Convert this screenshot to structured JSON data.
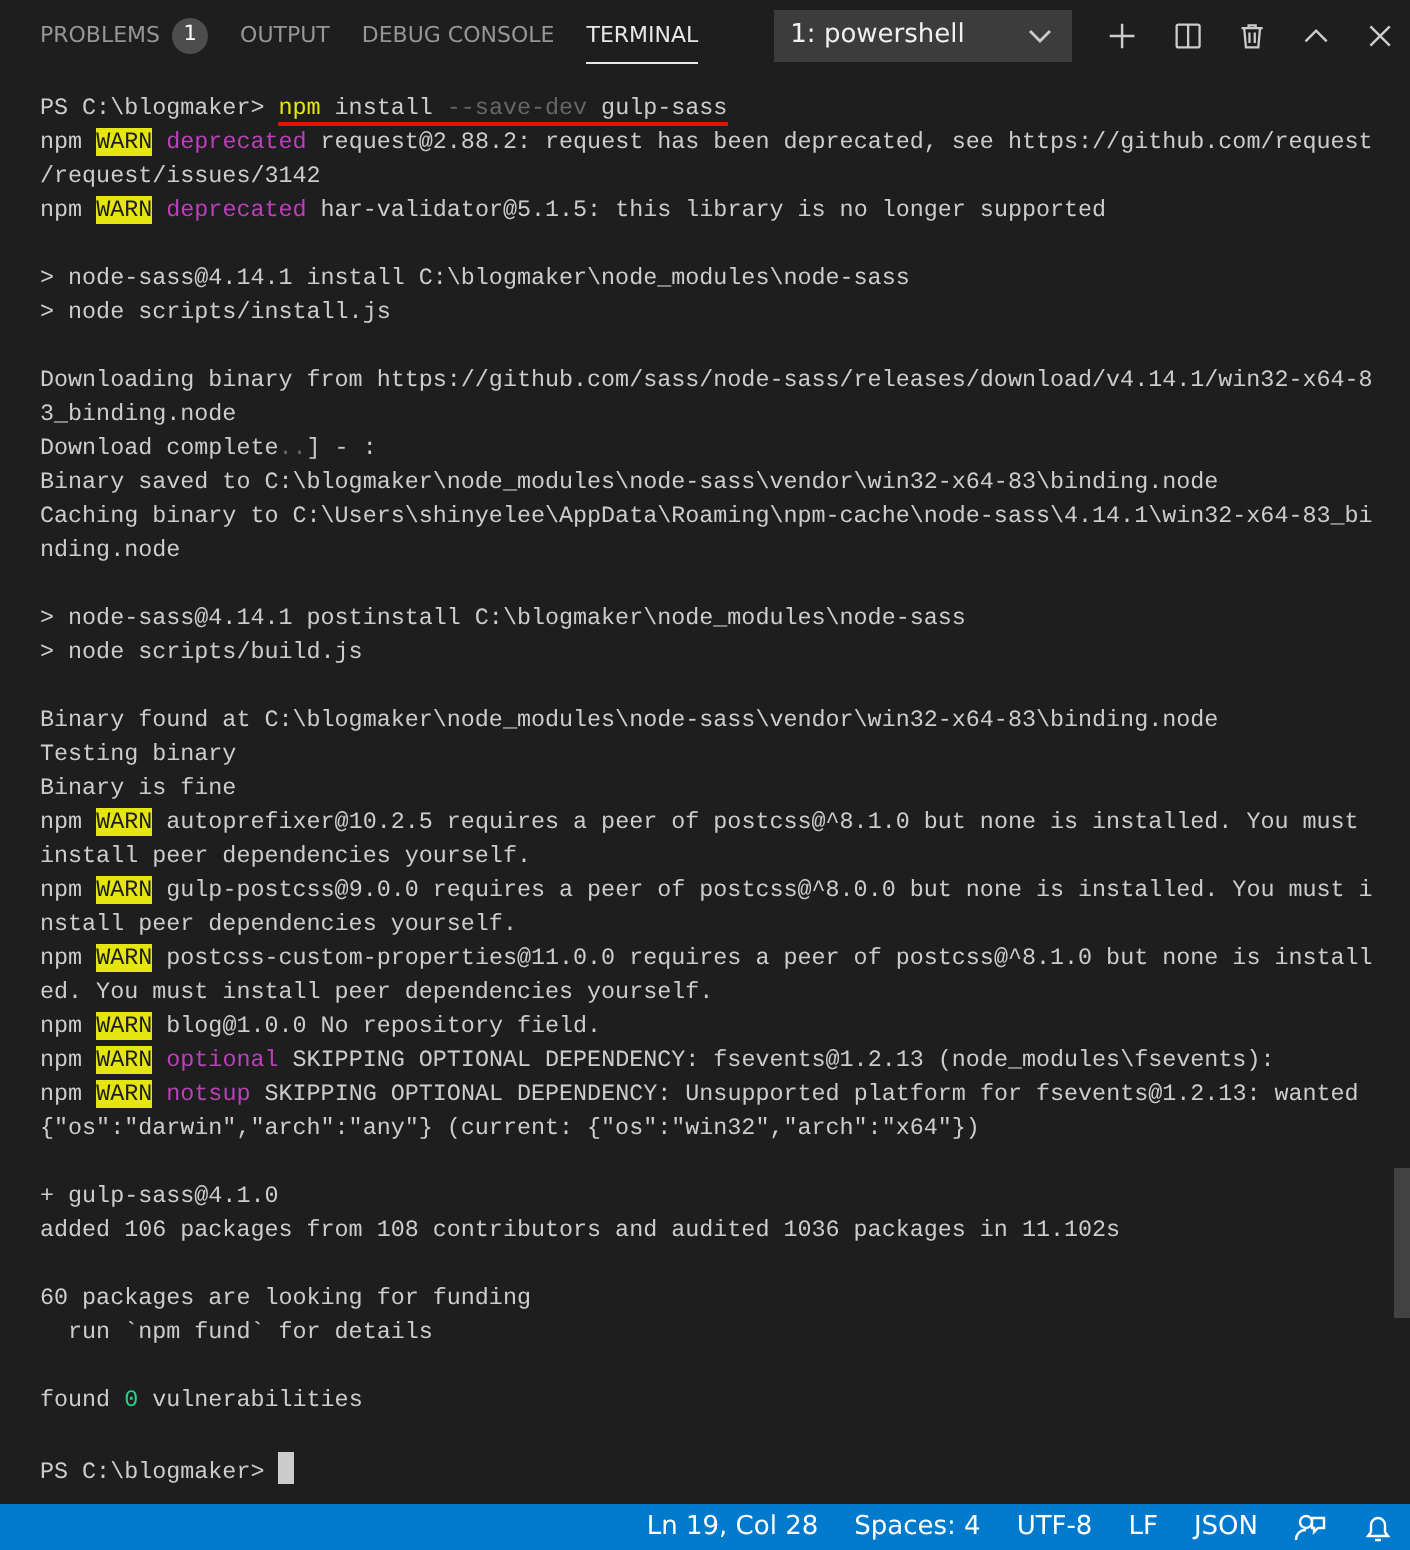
{
  "panel_tabs": [
    {
      "label": "PROBLEMS",
      "badge": "1",
      "selected": false
    },
    {
      "label": "OUTPUT",
      "selected": false
    },
    {
      "label": "DEBUG CONSOLE",
      "selected": false
    },
    {
      "label": "TERMINAL",
      "selected": true
    }
  ],
  "terminal_select": {
    "value": "1: powershell"
  },
  "terminal": {
    "rows": [
      {
        "kind": "command",
        "prompt": "PS C:\\blogmaker> ",
        "underlined": true,
        "segments": [
          {
            "kind": "cmd",
            "text": "npm"
          },
          {
            "kind": "text",
            "text": " install "
          },
          {
            "kind": "dim",
            "text": "--save-dev"
          },
          {
            "kind": "text",
            "text": " gulp-sass"
          }
        ]
      },
      {
        "kind": "output",
        "segments": [
          {
            "kind": "text",
            "text": "npm "
          },
          {
            "kind": "warn",
            "text": "WARN"
          },
          {
            "kind": "magenta",
            "text": " deprecated"
          },
          {
            "kind": "text",
            "text": " request@2.88.2: request has been deprecated, see https://github.com/request"
          }
        ]
      },
      {
        "kind": "output",
        "segments": [
          {
            "kind": "text",
            "text": "/request/issues/3142"
          }
        ]
      },
      {
        "kind": "output",
        "segments": [
          {
            "kind": "text",
            "text": "npm "
          },
          {
            "kind": "warn",
            "text": "WARN"
          },
          {
            "kind": "magenta",
            "text": " deprecated"
          },
          {
            "kind": "text",
            "text": " har-validator@5.1.5: this library is no longer supported"
          }
        ]
      },
      {
        "kind": "output",
        "blank_before": true,
        "segments": [
          {
            "kind": "text",
            "text": "> node-sass@4.14.1 install C:\\blogmaker\\node_modules\\node-sass"
          }
        ]
      },
      {
        "kind": "output",
        "segments": [
          {
            "kind": "text",
            "text": "> node scripts/install.js"
          }
        ]
      },
      {
        "kind": "output",
        "blank_before": true,
        "segments": [
          {
            "kind": "text",
            "text": "Downloading binary from https://github.com/sass/node-sass/releases/download/v4.14.1/win32-x64-8"
          }
        ]
      },
      {
        "kind": "output",
        "segments": [
          {
            "kind": "text",
            "text": "3_binding.node"
          }
        ]
      },
      {
        "kind": "output",
        "segments": [
          {
            "kind": "text",
            "text": "Download complete"
          },
          {
            "kind": "dim",
            "text": ".."
          },
          {
            "kind": "text",
            "text": "] - :"
          }
        ]
      },
      {
        "kind": "output",
        "segments": [
          {
            "kind": "text",
            "text": "Binary saved to C:\\blogmaker\\node_modules\\node-sass\\vendor\\win32-x64-83\\binding.node"
          }
        ]
      },
      {
        "kind": "output",
        "segments": [
          {
            "kind": "text",
            "text": "Caching binary to C:\\Users\\shinyelee\\AppData\\Roaming\\npm-cache\\node-sass\\4.14.1\\win32-x64-83_bi"
          }
        ]
      },
      {
        "kind": "output",
        "segments": [
          {
            "kind": "text",
            "text": "nding.node"
          }
        ]
      },
      {
        "kind": "output",
        "blank_before": true,
        "segments": [
          {
            "kind": "text",
            "text": "> node-sass@4.14.1 postinstall C:\\blogmaker\\node_modules\\node-sass"
          }
        ]
      },
      {
        "kind": "output",
        "segments": [
          {
            "kind": "text",
            "text": "> node scripts/build.js"
          }
        ]
      },
      {
        "kind": "output",
        "blank_before": true,
        "segments": [
          {
            "kind": "text",
            "text": "Binary found at C:\\blogmaker\\node_modules\\node-sass\\vendor\\win32-x64-83\\binding.node"
          }
        ]
      },
      {
        "kind": "output",
        "segments": [
          {
            "kind": "text",
            "text": "Testing binary"
          }
        ]
      },
      {
        "kind": "output",
        "segments": [
          {
            "kind": "text",
            "text": "Binary is fine"
          }
        ]
      },
      {
        "kind": "output",
        "segments": [
          {
            "kind": "text",
            "text": "npm "
          },
          {
            "kind": "warn",
            "text": "WARN"
          },
          {
            "kind": "text",
            "text": " autoprefixer@10.2.5 requires a peer of postcss@^8.1.0 but none is installed. You must"
          }
        ]
      },
      {
        "kind": "output",
        "segments": [
          {
            "kind": "text",
            "text": "install peer dependencies yourself."
          }
        ]
      },
      {
        "kind": "output",
        "segments": [
          {
            "kind": "text",
            "text": "npm "
          },
          {
            "kind": "warn",
            "text": "WARN"
          },
          {
            "kind": "text",
            "text": " gulp-postcss@9.0.0 requires a peer of postcss@^8.0.0 but none is installed. You must i"
          }
        ]
      },
      {
        "kind": "output",
        "segments": [
          {
            "kind": "text",
            "text": "nstall peer dependencies yourself."
          }
        ]
      },
      {
        "kind": "output",
        "segments": [
          {
            "kind": "text",
            "text": "npm "
          },
          {
            "kind": "warn",
            "text": "WARN"
          },
          {
            "kind": "text",
            "text": " postcss-custom-properties@11.0.0 requires a peer of postcss@^8.1.0 but none is install"
          }
        ]
      },
      {
        "kind": "output",
        "segments": [
          {
            "kind": "text",
            "text": "ed. You must install peer dependencies yourself."
          }
        ]
      },
      {
        "kind": "output",
        "segments": [
          {
            "kind": "text",
            "text": "npm "
          },
          {
            "kind": "warn",
            "text": "WARN"
          },
          {
            "kind": "text",
            "text": " blog@1.0.0 No repository field."
          }
        ]
      },
      {
        "kind": "output",
        "segments": [
          {
            "kind": "text",
            "text": "npm "
          },
          {
            "kind": "warn",
            "text": "WARN"
          },
          {
            "kind": "magenta",
            "text": " optional"
          },
          {
            "kind": "text",
            "text": " SKIPPING OPTIONAL DEPENDENCY: fsevents@1.2.13 (node_modules\\fsevents):"
          }
        ]
      },
      {
        "kind": "output",
        "segments": [
          {
            "kind": "text",
            "text": "npm "
          },
          {
            "kind": "warn",
            "text": "WARN"
          },
          {
            "kind": "magenta",
            "text": " notsup"
          },
          {
            "kind": "text",
            "text": " SKIPPING OPTIONAL DEPENDENCY: Unsupported platform for fsevents@1.2.13: wanted"
          }
        ]
      },
      {
        "kind": "output",
        "segments": [
          {
            "kind": "text",
            "text": "{\"os\":\"darwin\",\"arch\":\"any\"} (current: {\"os\":\"win32\",\"arch\":\"x64\"})"
          }
        ]
      },
      {
        "kind": "output",
        "blank_before": true,
        "segments": [
          {
            "kind": "text",
            "text": "+ gulp-sass@4.1.0"
          }
        ]
      },
      {
        "kind": "output",
        "segments": [
          {
            "kind": "text",
            "text": "added 106 packages from 108 contributors and audited 1036 packages in 11.102s"
          }
        ]
      },
      {
        "kind": "output",
        "blank_before": true,
        "segments": [
          {
            "kind": "text",
            "text": "60 packages are looking for funding"
          }
        ]
      },
      {
        "kind": "output",
        "segments": [
          {
            "kind": "text",
            "text": "  run `npm fund` for details"
          }
        ]
      },
      {
        "kind": "output",
        "blank_before": true,
        "segments": [
          {
            "kind": "text",
            "text": "found "
          },
          {
            "kind": "green",
            "text": "0"
          },
          {
            "kind": "text",
            "text": " vulnerabilities"
          }
        ]
      },
      {
        "kind": "prompt",
        "blank_before": true,
        "prompt": "PS C:\\blogmaker> "
      }
    ]
  },
  "status_bar": {
    "items": [
      "Ln 19, Col 28",
      "Spaces: 4",
      "UTF-8",
      "LF",
      "JSON"
    ]
  }
}
